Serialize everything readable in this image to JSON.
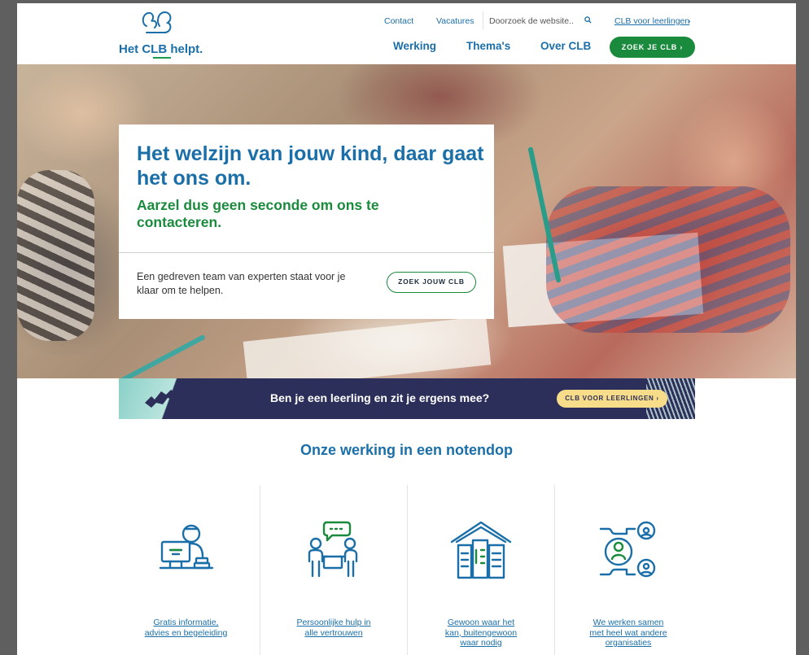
{
  "header": {
    "logo_text": "Het CLB helpt.",
    "utility": {
      "contact": "Contact",
      "vacatures": "Vacatures",
      "search_placeholder": "Doorzoek de website..",
      "leerlingen_link": "CLB voor leerlingen",
      "leerlingen_chevron": "›"
    },
    "nav": {
      "werking": "Werking",
      "themas": "Thema's",
      "over": "Over CLB"
    },
    "cta": "ZOEK JE CLB ›"
  },
  "hero": {
    "title": "Het welzijn van jouw kind, daar gaat het ons om.",
    "subtitle": "Aarzel dus geen seconde om ons te contacteren.",
    "body": "Een gedreven team van experten staat voor je klaar om te helpen.",
    "button": "ZOEK JOUW CLB"
  },
  "banner": {
    "text": "Ben je een leerling en zit je ergens mee?",
    "button": "CLB VOOR LEERLINGEN ›"
  },
  "section": {
    "title": "Onze werking in een notendop",
    "features": [
      {
        "label": "Gratis informatie, advies en begeleiding",
        "icon": "computer-person-icon"
      },
      {
        "label": "Persoonlijke hulp in alle vertrouwen",
        "icon": "conversation-icon"
      },
      {
        "label": "Gewoon waar het kan, buitengewoon waar nodig",
        "icon": "school-building-icon"
      },
      {
        "label": "We werken samen met heel wat andere organisaties",
        "icon": "network-people-icon"
      }
    ]
  },
  "colors": {
    "brand_blue": "#1b6fa8",
    "brand_green": "#1a8a3c",
    "banner_navy": "#2d2f5b",
    "banner_yellow": "#f7dc89"
  }
}
